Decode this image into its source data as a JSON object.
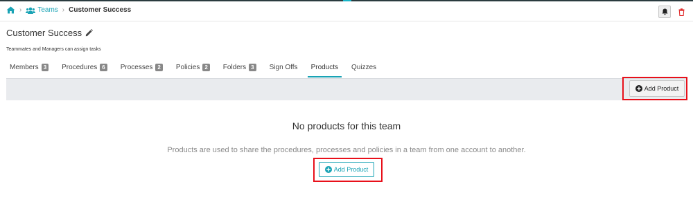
{
  "breadcrumb": {
    "home_icon": "home-icon",
    "teams_icon": "users-icon",
    "teams_label": "Teams",
    "current_label": "Customer Success"
  },
  "header_actions": {
    "bell_icon": "bell-icon",
    "trash_icon": "trash-icon"
  },
  "team": {
    "name": "Customer Success",
    "edit_icon": "pencil-icon",
    "description": "Teammates and Managers can assign tasks"
  },
  "tabs": [
    {
      "label": "Members",
      "count": "3"
    },
    {
      "label": "Procedures",
      "count": "6"
    },
    {
      "label": "Processes",
      "count": "2"
    },
    {
      "label": "Policies",
      "count": "2"
    },
    {
      "label": "Folders",
      "count": "3"
    },
    {
      "label": "Sign Offs",
      "count": ""
    },
    {
      "label": "Products",
      "count": "",
      "active": true
    },
    {
      "label": "Quizzes",
      "count": ""
    }
  ],
  "toolbar": {
    "add_product_label": "Add Product"
  },
  "empty_state": {
    "title": "No products for this team",
    "description": "Products are used to share the procedures, processes and policies in a team from one account to another.",
    "add_product_label": "Add Product"
  },
  "colors": {
    "accent": "#19a3b5",
    "highlight": "#e8101a",
    "toolbar_bg": "#e9ebee",
    "badge": "#888888"
  }
}
